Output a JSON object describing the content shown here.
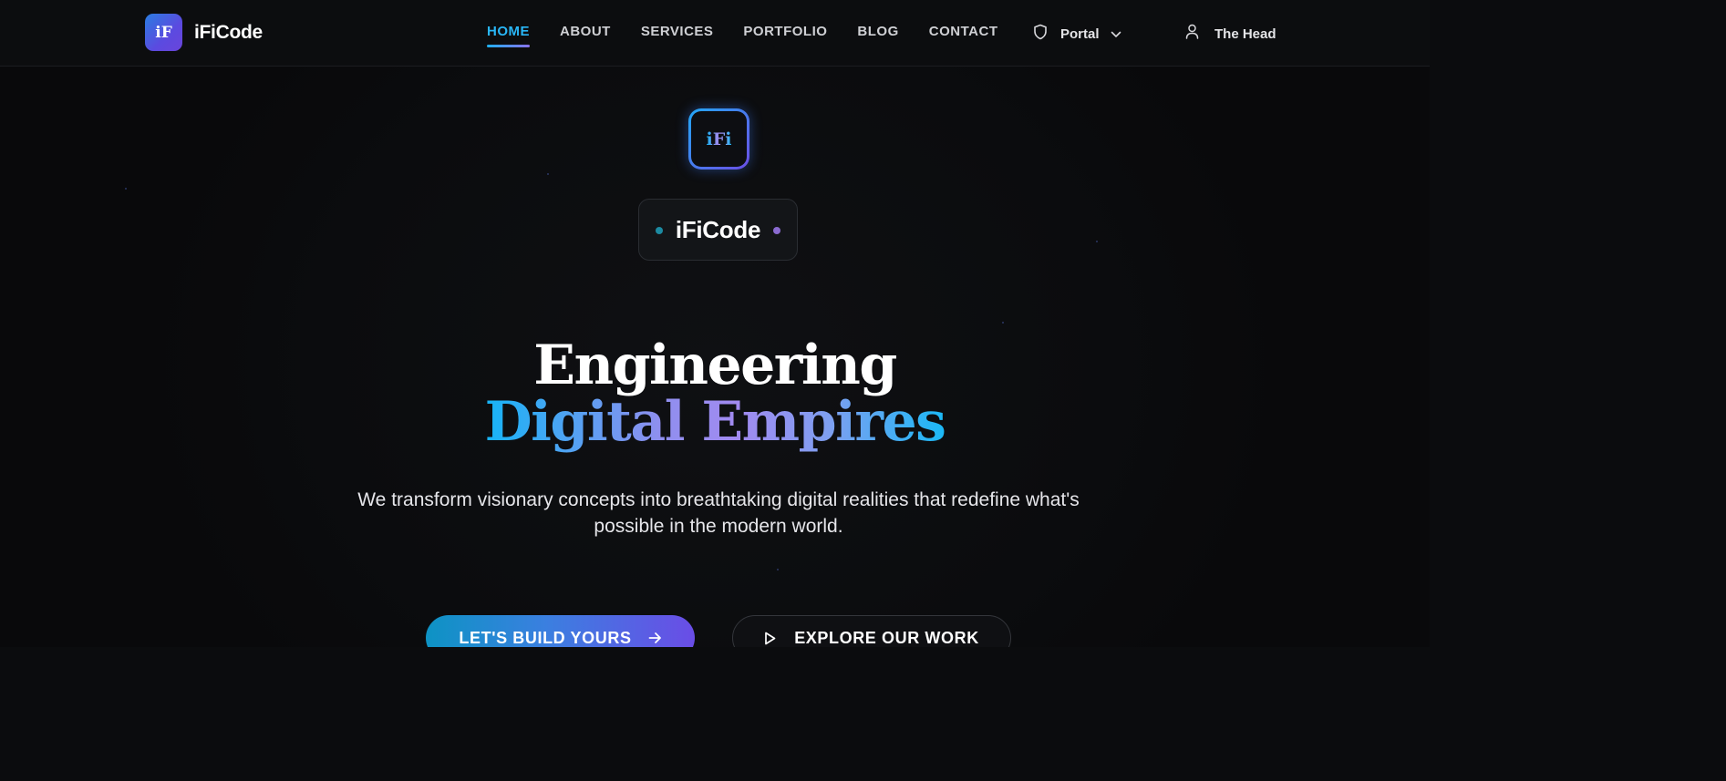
{
  "nav": {
    "brand_logo_text": "iF",
    "brand_name": "iFiCode",
    "links": [
      {
        "label": "HOME",
        "active": true
      },
      {
        "label": "ABOUT",
        "active": false
      },
      {
        "label": "SERVICES",
        "active": false
      },
      {
        "label": "PORTFOLIO",
        "active": false
      },
      {
        "label": "BLOG",
        "active": false
      },
      {
        "label": "CONTACT",
        "active": false
      }
    ],
    "portal": {
      "label": "Portal",
      "icon": "shield-icon",
      "dropdown_icon": "chevron-down-icon"
    },
    "user": {
      "label": "The Head",
      "icon": "user-icon"
    }
  },
  "hero": {
    "icon_text": "iFi",
    "badge_text": "iFiCode",
    "headline_line1": "Engineering",
    "headline_line2": "Digital Empires",
    "subtitle": "We transform visionary concepts into breathtaking digital realities that redefine what's possible in the modern world.",
    "primary_button": {
      "label": "LET'S BUILD YOURS",
      "icon": "arrow-right-icon"
    },
    "secondary_button": {
      "label": "EXPLORE OUR WORK",
      "icon": "play-icon"
    }
  },
  "colors": {
    "accent_blue": "#29b6f6",
    "accent_purple": "#6a4de6",
    "background": "#0b0c0e"
  }
}
